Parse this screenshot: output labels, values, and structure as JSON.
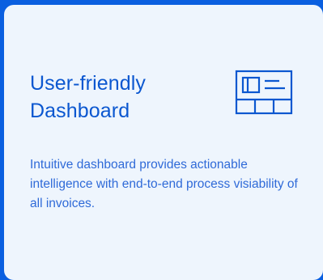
{
  "card": {
    "title": "User-friendly Dashboard",
    "description": "Intuitive dashboard provides actionable intelligence with end-to-end process visiability of all invoices.",
    "icon": "dashboard-layout-icon"
  },
  "colors": {
    "background": "#0a5fe0",
    "card": "#eef5fd",
    "accent": "#0b57d0",
    "text": "#2f6ad8"
  }
}
